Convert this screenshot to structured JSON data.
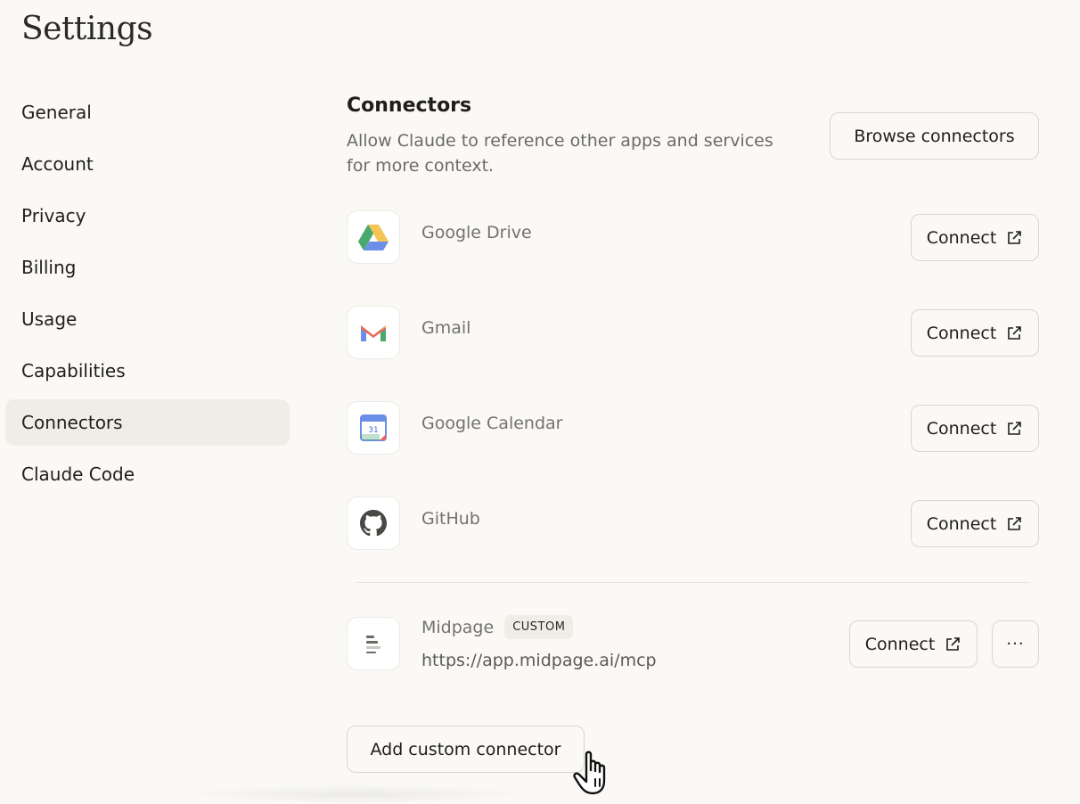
{
  "page": {
    "title": "Settings"
  },
  "sidebar": {
    "items": [
      {
        "label": "General"
      },
      {
        "label": "Account"
      },
      {
        "label": "Privacy"
      },
      {
        "label": "Billing"
      },
      {
        "label": "Usage"
      },
      {
        "label": "Capabilities"
      },
      {
        "label": "Connectors",
        "active": true
      },
      {
        "label": "Claude Code"
      }
    ]
  },
  "connectors": {
    "title": "Connectors",
    "description": "Allow Claude to reference other apps and services for more context.",
    "browse_label": "Browse connectors",
    "items": [
      {
        "name": "Google Drive",
        "icon": "google-drive-icon",
        "action": "Connect"
      },
      {
        "name": "Gmail",
        "icon": "gmail-icon",
        "action": "Connect"
      },
      {
        "name": "Google Calendar",
        "icon": "google-calendar-icon",
        "action": "Connect",
        "calendar_day": "31"
      },
      {
        "name": "GitHub",
        "icon": "github-icon",
        "action": "Connect"
      }
    ],
    "custom": {
      "name": "Midpage",
      "badge": "CUSTOM",
      "url": "https://app.midpage.ai/mcp",
      "action": "Connect",
      "more": "···"
    },
    "add_label": "Add custom connector"
  },
  "colors": {
    "background": "#faf9f5",
    "active_nav": "#efede6",
    "border": "#d9d6cc",
    "muted_text": "#73726d"
  }
}
